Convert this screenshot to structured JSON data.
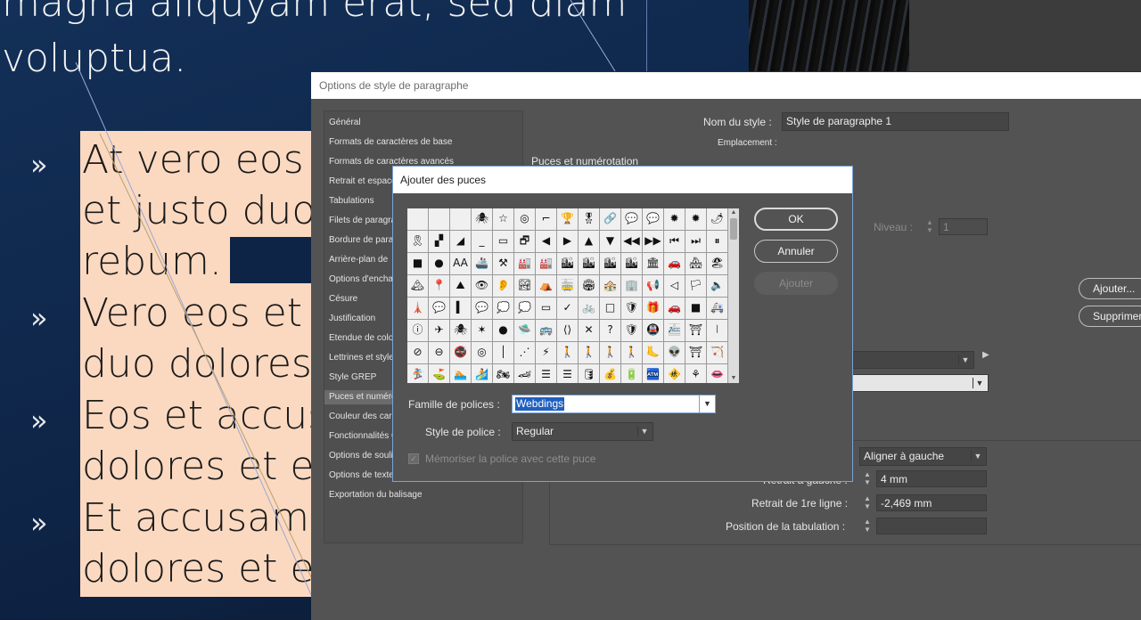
{
  "document": {
    "top_lines": [
      "magna aliquyam erat, sed diam",
      "voluptua."
    ],
    "bullet_char": "»",
    "frame_lines": [
      "At vero eos e",
      "et justo duo",
      "rebum.",
      "Vero eos et",
      "duo dolores",
      "Eos et accus",
      "dolores et e",
      "Et accusam",
      "dolores et e"
    ]
  },
  "main_dialog": {
    "title": "Options de style de paragraphe",
    "categories": [
      "Général",
      "Formats de caractères de base",
      "Formats de caractères avancés",
      "Retrait et espace",
      "Tabulations",
      "Filets de paragra",
      "Bordure de para",
      "Arrière-plan de",
      "Options d'encha",
      "Césure",
      "Justification",
      "Etendue de colo",
      "Lettrines et style",
      "Style GREP",
      "Puces et numéro",
      "Couleur des cara",
      "Fonctionnalités O",
      "Options de souli",
      "Options de texte",
      "Exportation du balisage"
    ],
    "selected_category_index": 14,
    "style_name_label": "Nom du style :",
    "style_name_value": "Style de paragraphe 1",
    "location_label": "Emplacement :",
    "section_title": "Puces et numérotation",
    "level_label": "Niveau :",
    "level_value": "1",
    "add_button": "Ajouter...",
    "delete_button": "Supprimer",
    "align_value": "Aligner à gauche",
    "left_indent_label": "Retrait à gauche :",
    "left_indent_value": "4 mm",
    "first_line_label": "Retrait de 1re ligne :",
    "first_line_value": "-2,469 mm",
    "tab_position_label": "Position de la tabulation :",
    "tab_position_value": ""
  },
  "bullets_dialog": {
    "title": "Ajouter des puces",
    "ok_button": "OK",
    "cancel_button": "Annuler",
    "add_button": "Ajouter",
    "font_family_label": "Famille de polices :",
    "font_family_value": "Webdings",
    "font_style_label": "Style de police :",
    "font_style_value": "Regular",
    "remember_label": "Mémoriser la police avec cette puce",
    "remember_checked": true,
    "glyph_rows": [
      [
        "",
        "",
        "",
        "🕷",
        "☆",
        "◎",
        "⌐",
        "🏆",
        "🎖",
        "🔗",
        "💬",
        "💬",
        "✹",
        "✹",
        "🌶"
      ],
      [
        "🎗",
        "▞",
        "◢",
        "_",
        "▭",
        "🗗",
        "◀",
        "▶",
        "▲",
        "▼",
        "◀◀",
        "▶▶",
        "⏮",
        "⏭",
        "⏸"
      ],
      [
        "■",
        "●",
        "AA",
        "🚢",
        "⚒",
        "🏭",
        "🏭",
        "🏙",
        "🏙",
        "🏙",
        "🏙",
        "🏛",
        "🚗",
        "🏘",
        "🏖"
      ],
      [
        "🏔",
        "📍",
        "⛰",
        "👁",
        "👂",
        "🏞",
        "⛺",
        "🚋",
        "🏟",
        "🏤",
        "🏢",
        "📢",
        "◁",
        "🏳",
        "🔈",
        "❤"
      ],
      [
        "🗼",
        "💬",
        "▍",
        "💬",
        "💭",
        "💭",
        "▭",
        "✓",
        "🚲",
        "□",
        "🛡",
        "🎁",
        "🚗",
        "■",
        "🚑"
      ],
      [
        "ⓘ",
        "✈",
        "🕷",
        "✶",
        "●",
        "🛸",
        "🚌",
        "⟨⟩",
        "✕",
        "?",
        "🛡",
        "🚇",
        "🚈",
        "⛩",
        "⦚"
      ],
      [
        "⊘",
        "⊖",
        "🚭",
        "◎",
        "│",
        "⋰",
        "⚡",
        "🚶",
        "🚶",
        "🚶",
        "🚶",
        "🦶",
        "👽",
        "⛩",
        "🏹"
      ],
      [
        "🏂",
        "⛳",
        "🏊",
        "🏄",
        "🏍",
        "🏎",
        "☰",
        "☰",
        "🛢",
        "💰",
        "🔋",
        "🏧",
        "🚸",
        "⚘",
        "👄"
      ]
    ]
  },
  "colors": {
    "doc_background": "#0e2446",
    "text_frame": "#fbd9c0",
    "dialog_background": "#535353",
    "dialog_border": "#7aa3d9",
    "selection_highlight": "#1f5fbf"
  }
}
